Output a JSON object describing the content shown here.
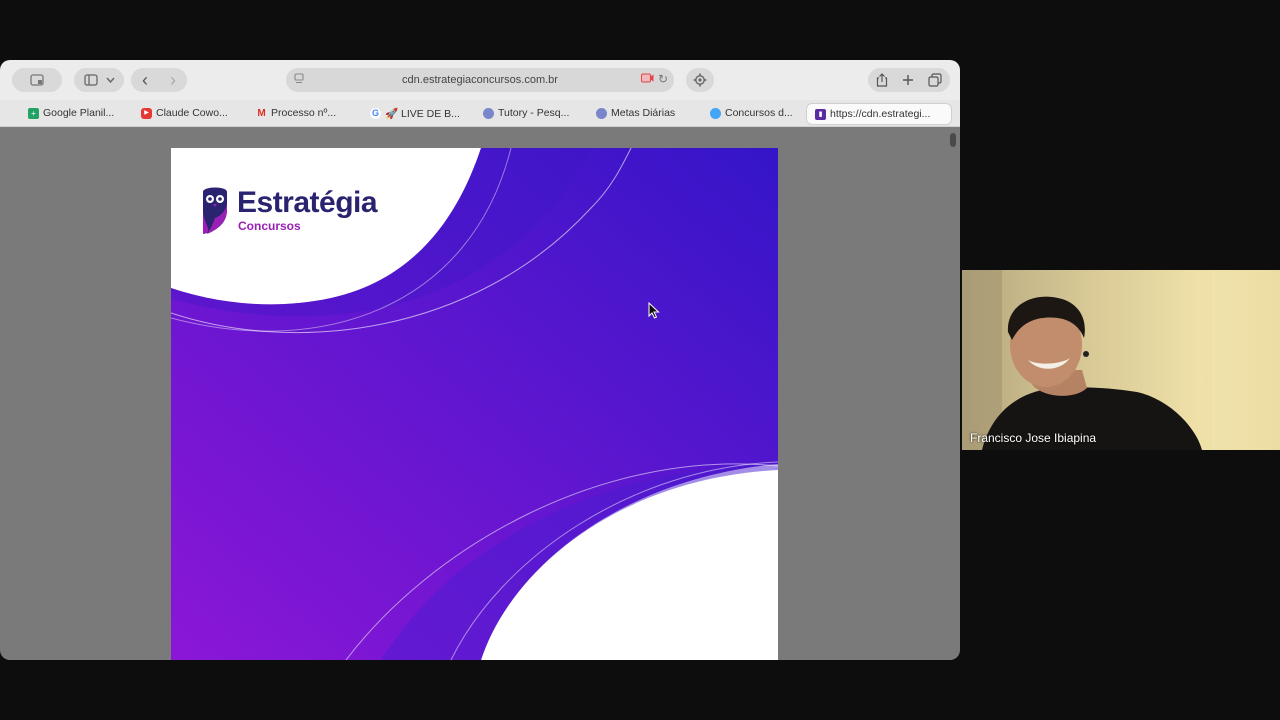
{
  "browser": {
    "address": "cdn.estrategiaconcursos.com.br",
    "nav": {
      "back": "‹",
      "forward": "›"
    },
    "toolbar_icons": [
      "tab-overview-icon",
      "sidebar-icon",
      "chevron-down-icon",
      "back-icon",
      "forward-icon",
      "reader-icon",
      "recording-icon",
      "reload-icon",
      "settings-icon",
      "share-icon",
      "new-tab-icon",
      "tabs-icon"
    ],
    "bookmarks": [
      {
        "label": "Google Planil...",
        "icon": "sheets-icon",
        "color": "#21a366"
      },
      {
        "label": "Claude Cowo...",
        "icon": "youtube-icon",
        "color": "#e53935"
      },
      {
        "label": "Processo nº...",
        "icon": "gmail-icon",
        "color": "#d93025"
      },
      {
        "label": "🚀 LIVE DE B...",
        "icon": "g-icon",
        "color": "#4285f4"
      },
      {
        "label": "Tutory - Pesq...",
        "icon": "globe-icon",
        "color": "#5c6bc0"
      },
      {
        "label": "Metas Diárias",
        "icon": "globe-icon",
        "color": "#5c6bc0"
      },
      {
        "label": "Concursos d...",
        "icon": "globe-icon",
        "color": "#42a5f5"
      },
      {
        "label": "https://cdn.estrategi...",
        "icon": "doc-icon",
        "color": "#5b2ca0"
      }
    ]
  },
  "document": {
    "brand": "Estratégia",
    "brand_sub": "Concursos",
    "colors": {
      "violet": "#8b17d6",
      "blue": "#3a16c9",
      "navy": "#2a2370"
    }
  },
  "call": {
    "participant_name": "Francisco Jose Ibiapina"
  }
}
